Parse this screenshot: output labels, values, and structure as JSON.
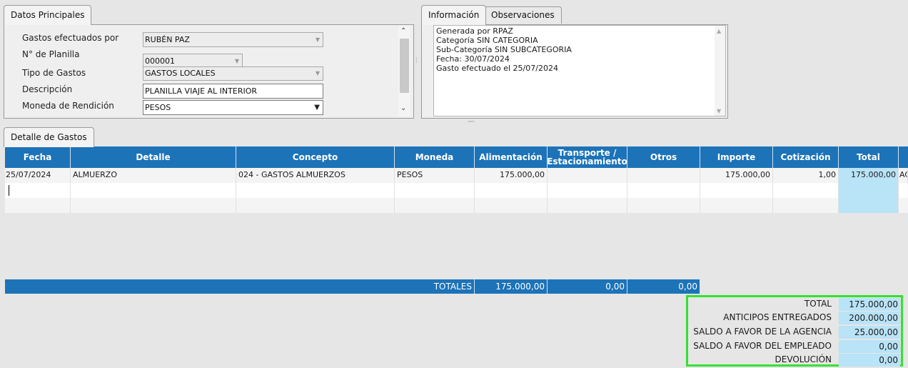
{
  "datos": {
    "tab_label": "Datos Principales",
    "fields": [
      {
        "label": "Gastos efectuados por",
        "value": "RUBÉN PAZ"
      },
      {
        "label": "N° de Planilla",
        "value": "000001"
      },
      {
        "label": "Tipo de Gastos",
        "value": "GASTOS LOCALES"
      },
      {
        "label": "Descripción",
        "value": "PLANILLA VIAJE AL INTERIOR"
      },
      {
        "label": "Moneda de Rendición",
        "value": "PESOS"
      }
    ]
  },
  "info": {
    "tabs": [
      "Información",
      "Observaciones"
    ],
    "lines": [
      "Generada por RPAZ",
      "Categoría SIN CATEGORIA",
      "Sub-Categoría SIN SUBCATEGORIA",
      "Fecha: 30/07/2024",
      "Gasto efectuado el 25/07/2024"
    ]
  },
  "detalle": {
    "tab_label": "Detalle de Gastos",
    "columns": [
      "Fecha",
      "Detalle",
      "Concepto",
      "Moneda",
      "Alimentación",
      "Transporte /\nEstacionamiento",
      "Otros",
      "Importe",
      "Cotización",
      "Total"
    ],
    "rows": [
      {
        "fecha": "25/07/2024",
        "detalle": "ALMUERZO",
        "concepto": "024 - GASTOS ALMUERZOS",
        "moneda": "PESOS",
        "alimentacion": "175.000,00",
        "transporte": "",
        "otros": "",
        "importe": "175.000,00",
        "cotizacion": "1,00",
        "total": "175.000,00",
        "extra": "AC"
      }
    ]
  },
  "totales": {
    "label": "TOTALES",
    "alimentacion": "175.000,00",
    "transporte": "0,00",
    "otros": "0,00"
  },
  "resumen": [
    {
      "label": "TOTAL",
      "value": "175.000,00"
    },
    {
      "label": "ANTICIPOS ENTREGADOS",
      "value": "200.000,00"
    },
    {
      "label": "SALDO A FAVOR DE LA AGENCIA",
      "value": "25.000,00"
    },
    {
      "label": "SALDO A FAVOR DEL EMPLEADO",
      "value": "0,00"
    },
    {
      "label": "DEVOLUCIÓN",
      "value": "0,00"
    }
  ],
  "colors": {
    "header_blue": "#1c73b8",
    "total_column": "#b9e3f7",
    "highlight_box": "#32e232"
  }
}
